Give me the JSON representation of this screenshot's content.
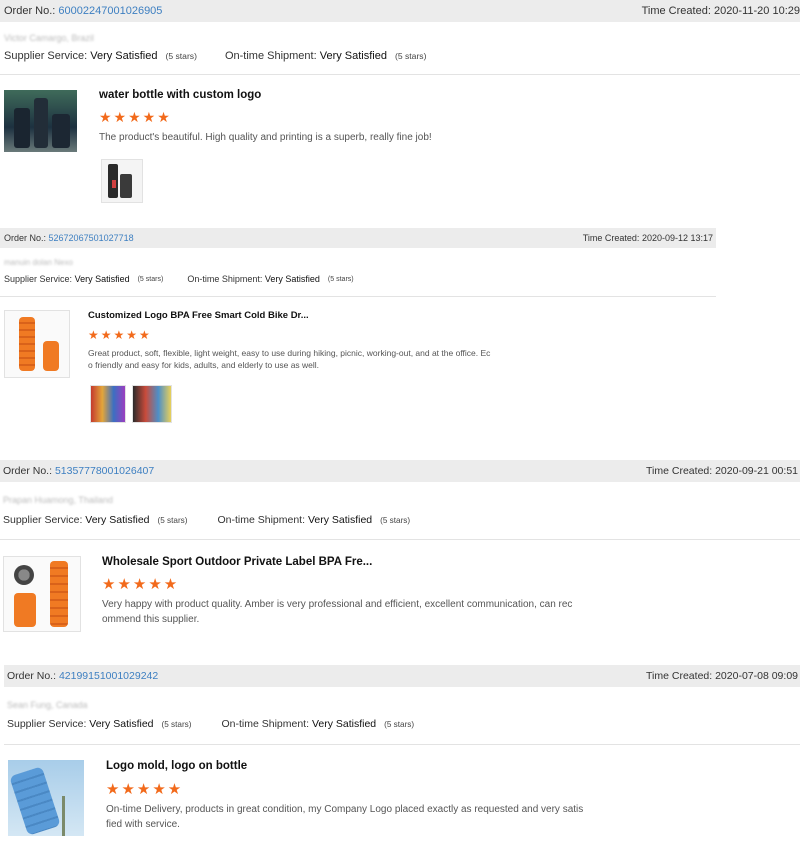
{
  "labels": {
    "order_no": "Order No.:",
    "time_created": "Time Created:",
    "supplier_service": "Supplier Service:",
    "ontime_shipment": "On-time Shipment:"
  },
  "reviews": [
    {
      "order_no": "60002247001026905",
      "time_created": "2020-11-20 10:29",
      "buyer": "Victor Camargo, Brazil",
      "supplier_rating": "Very Satisfied",
      "supplier_stars": "(5 stars)",
      "shipment_rating": "Very Satisfied",
      "shipment_stars": "(5 stars)",
      "product": "water bottle with custom logo",
      "stars": "★★★★★",
      "comment": "The product's beautiful. High quality and printing is a superb, really fine job!"
    },
    {
      "order_no": "52672067501027718",
      "time_created": "2020-09-12 13:17",
      "buyer": "manuin dolan Nexo",
      "supplier_rating": "Very Satisfied",
      "supplier_stars": "(5 stars)",
      "shipment_rating": "Very Satisfied",
      "shipment_stars": "(5 stars)",
      "product": "Customized Logo BPA Free Smart Cold Bike Dr...",
      "stars": "★★★★★",
      "comment_line1": "Great product, soft, flexible, light weight, easy to use during hiking, picnic, working-out, and at the office. Ec",
      "comment_line2": "o friendly and easy for kids, adults, and elderly to use as well."
    },
    {
      "order_no": "51357778001026407",
      "time_created": "2020-09-21 00:51",
      "buyer": "Prapan Huamong, Thailand",
      "supplier_rating": "Very Satisfied",
      "supplier_stars": "(5 stars)",
      "shipment_rating": "Very Satisfied",
      "shipment_stars": "(5 stars)",
      "product": "Wholesale Sport Outdoor Private Label BPA Fre...",
      "stars": "★★★★★",
      "comment_line1": "Very happy with product quality. Amber is very professional and efficient, excellent communication, can rec",
      "comment_line2": "ommend this supplier."
    },
    {
      "order_no": "42199151001029242",
      "time_created": "2020-07-08 09:09",
      "buyer": "Sean Fung, Canada",
      "supplier_rating": "Very Satisfied",
      "supplier_stars": "(5 stars)",
      "shipment_rating": "Very Satisfied",
      "shipment_stars": "(5 stars)",
      "product": "Logo mold, logo on bottle",
      "stars": "★★★★★",
      "comment_line1": "On-time Delivery, products in great condition, my Company Logo placed exactly as requested and very satis",
      "comment_line2": "fied with service."
    }
  ],
  "colors": {
    "link": "#3d7fc1",
    "star": "#f26a1b",
    "bar": "#ececec"
  }
}
